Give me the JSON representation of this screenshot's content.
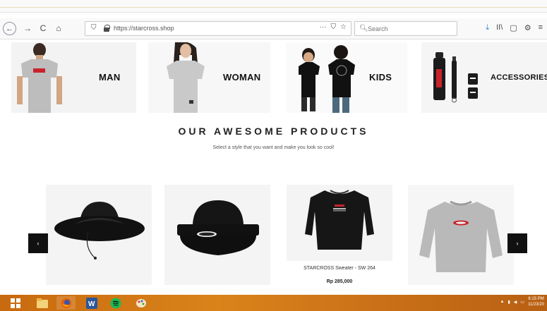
{
  "browser": {
    "url": "https://starcross.shop",
    "search_placeholder": "Search",
    "back_icon": "←",
    "forward_icon": "→",
    "reload_icon": "C",
    "home_icon": "⌂",
    "url_actions": [
      "···",
      "⛉",
      "☆"
    ],
    "toolbar_icons": [
      "⤓",
      "II\\",
      "▢",
      "⚙",
      "≡"
    ]
  },
  "categories": [
    {
      "label": "MAN"
    },
    {
      "label": "WOMAN"
    },
    {
      "label": "KIDS"
    },
    {
      "label": "ACCESSORIES"
    }
  ],
  "section": {
    "title": "OUR AWESOME PRODUCTS",
    "subtitle": "Select a style that you want and make you look so cool!"
  },
  "products": [
    {
      "name": "",
      "price": ""
    },
    {
      "name": "",
      "price": ""
    },
    {
      "name": "STARCROSS Sweater - SW 264",
      "price": "Rp 285,000"
    },
    {
      "name": "",
      "price": ""
    }
  ],
  "carousel": {
    "prev": "‹",
    "next": "›"
  },
  "taskbar": {
    "time": "6:15 PM",
    "date": "11/23/20"
  },
  "colors": {
    "taskbar": "#d9831a",
    "arrow_bg": "#111111",
    "brand_red": "#c8232c"
  }
}
